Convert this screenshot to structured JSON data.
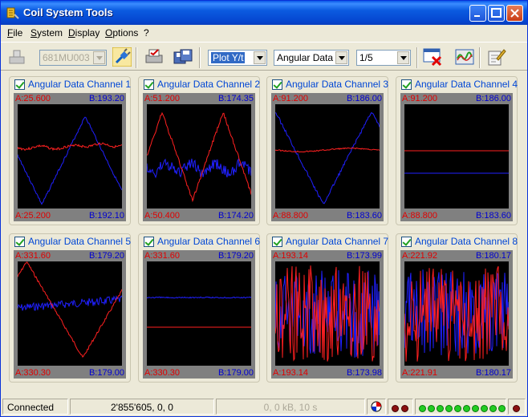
{
  "window": {
    "title": "Coil System Tools"
  },
  "menu": [
    {
      "label": "File",
      "key": "F",
      "rest": "ile"
    },
    {
      "label": "System",
      "key": "S",
      "rest": "ystem"
    },
    {
      "label": "Display",
      "key": "D",
      "rest": "isplay"
    },
    {
      "label": "Options",
      "key": "O",
      "rest": "ptions"
    },
    {
      "label": "?",
      "key": "",
      "rest": "?"
    }
  ],
  "toolbar": {
    "device_combo": "681MU003",
    "plot_mode_combo": "Plot Y/t",
    "data_type_combo": "Angular Data",
    "page_combo": "1/5"
  },
  "channels": [
    {
      "title": "Angular Data Channel 1",
      "a_top": "A:25.600",
      "b_top": "B:193.20",
      "a_bot": "A:25.200",
      "b_bot": "B:192.10",
      "pattern": "tri1"
    },
    {
      "title": "Angular Data Channel 2",
      "a_top": "A:51.200",
      "b_top": "B:174.35",
      "a_bot": "A:50.400",
      "b_bot": "B:174.20",
      "pattern": "tri2"
    },
    {
      "title": "Angular Data Channel 3",
      "a_top": "A:91.200",
      "b_top": "B:186.00",
      "a_bot": "A:88.800",
      "b_bot": "B:183.60",
      "pattern": "tri3"
    },
    {
      "title": "Angular Data Channel 4",
      "a_top": "A:91.200",
      "b_top": "B:186.00",
      "a_bot": "A:88.800",
      "b_bot": "B:183.60",
      "pattern": "flat4"
    },
    {
      "title": "Angular Data Channel 5",
      "a_top": "A:331.60",
      "b_top": "B:179.20",
      "a_bot": "A:330.30",
      "b_bot": "B:179.00",
      "pattern": "tri5"
    },
    {
      "title": "Angular Data Channel 6",
      "a_top": "A:331.60",
      "b_top": "B:179.20",
      "a_bot": "A:330.30",
      "b_bot": "B:179.00",
      "pattern": "flat6"
    },
    {
      "title": "Angular Data Channel 7",
      "a_top": "A:193.14",
      "b_top": "B:173.99",
      "a_bot": "A:193.14",
      "b_bot": "B:173.98",
      "pattern": "noise"
    },
    {
      "title": "Angular Data Channel 8",
      "a_top": "A:221.92",
      "b_top": "B:180.17",
      "a_bot": "A:221.91",
      "b_bot": "B:180.17",
      "pattern": "noise"
    }
  ],
  "status": {
    "connection": "Connected",
    "counter": "2'855'605, 0, 0",
    "transfer": "0, 0 kB, 10 s"
  },
  "colors": {
    "a_trace": "#FF2020",
    "b_trace": "#2020FF",
    "accent": "#0046D5"
  }
}
